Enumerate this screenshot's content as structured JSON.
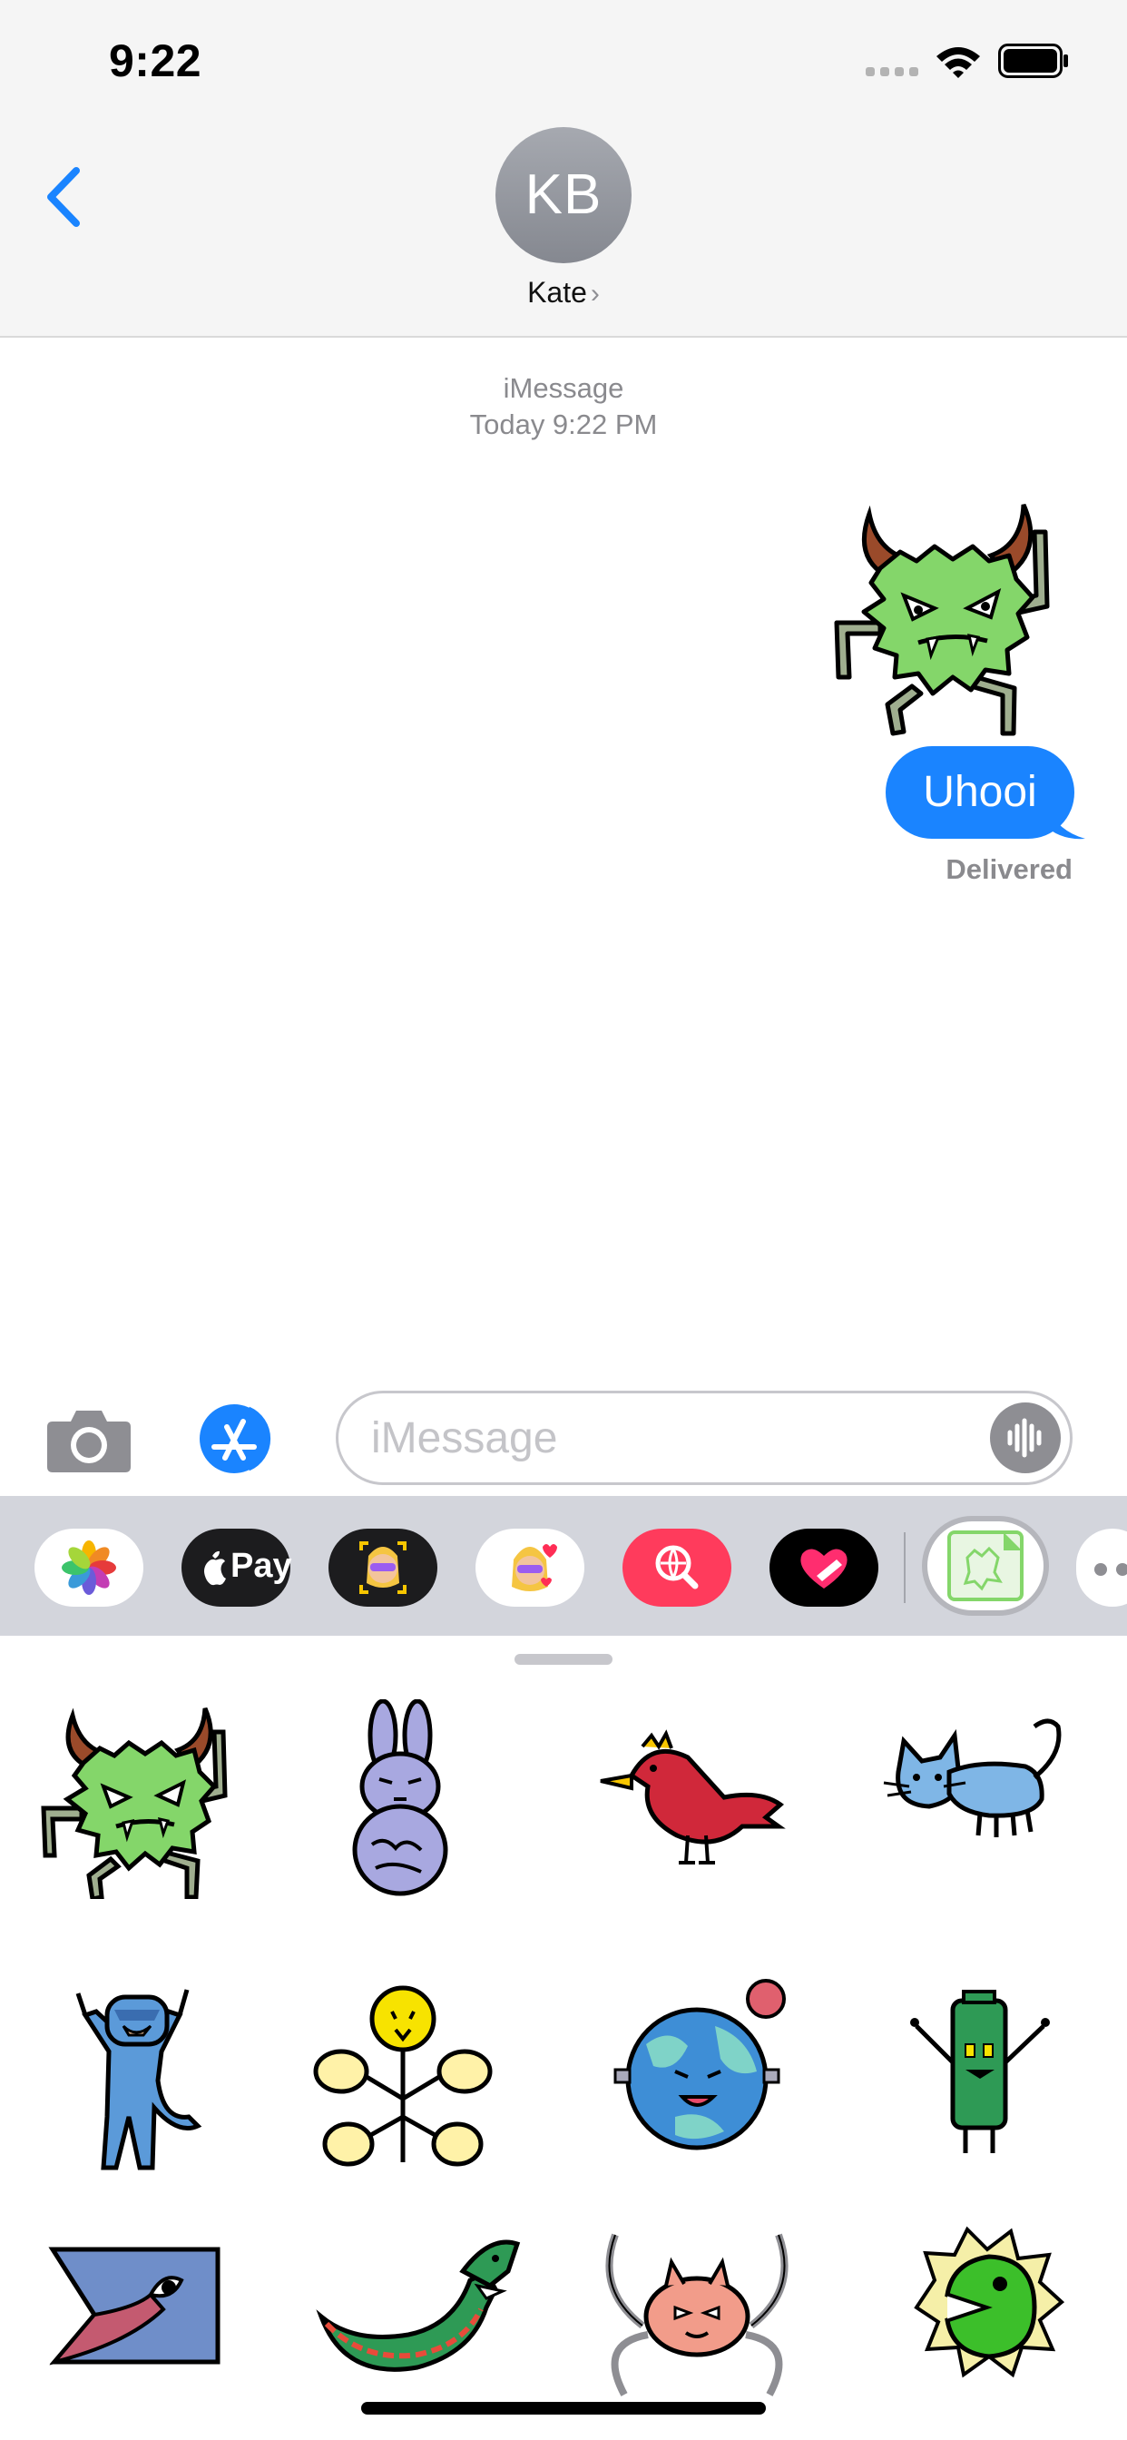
{
  "status_bar": {
    "time": "9:22"
  },
  "header": {
    "avatar_initials": "KB",
    "contact_name": "Kate",
    "contact_chevron": "›"
  },
  "conversation": {
    "service": "iMessage",
    "timestamp": "Today 9:22 PM",
    "messages": [
      {
        "kind": "sticker",
        "icon": "green-horned-monster-sticker",
        "from": "me"
      },
      {
        "kind": "text",
        "text": "Uhooi",
        "from": "me"
      }
    ],
    "delivery_status": "Delivered"
  },
  "composer": {
    "placeholder": "iMessage",
    "value": ""
  },
  "app_strip": {
    "apps": [
      {
        "name": "Photos",
        "icon": "photos-icon"
      },
      {
        "name": "Apple Pay",
        "label": "Pay",
        "icon": "apple-pay-icon"
      },
      {
        "name": "Memoji",
        "icon": "memoji-camera-icon"
      },
      {
        "name": "Memoji Stickers",
        "icon": "memoji-stickers-icon"
      },
      {
        "name": "Images",
        "icon": "globe-search-icon"
      },
      {
        "name": "Digital Touch",
        "icon": "digital-touch-heart-icon"
      },
      {
        "name": "Uhooi Stickers",
        "icon": "uhooi-sticker-app-icon",
        "selected": true
      }
    ]
  },
  "sticker_grid": [
    "green-horned-monster-sticker",
    "purple-rabbit-sticker",
    "red-bird-sticker",
    "blue-cat-sticker",
    "blue-cat-waving-sticker",
    "yellow-flower-sticker",
    "earth-planet-sticker",
    "green-battery-sticker",
    "blue-shark-head-sticker",
    "green-dragon-sticker",
    "pink-crab-sticker",
    "green-spiky-chomper-sticker"
  ],
  "colors": {
    "accent": "#1a84ff",
    "header_bg": "#f5f5f5",
    "drawer_bg": "#d3d5dc",
    "monster_green": "#84d66a",
    "secondary_text": "#8a8a8e"
  }
}
